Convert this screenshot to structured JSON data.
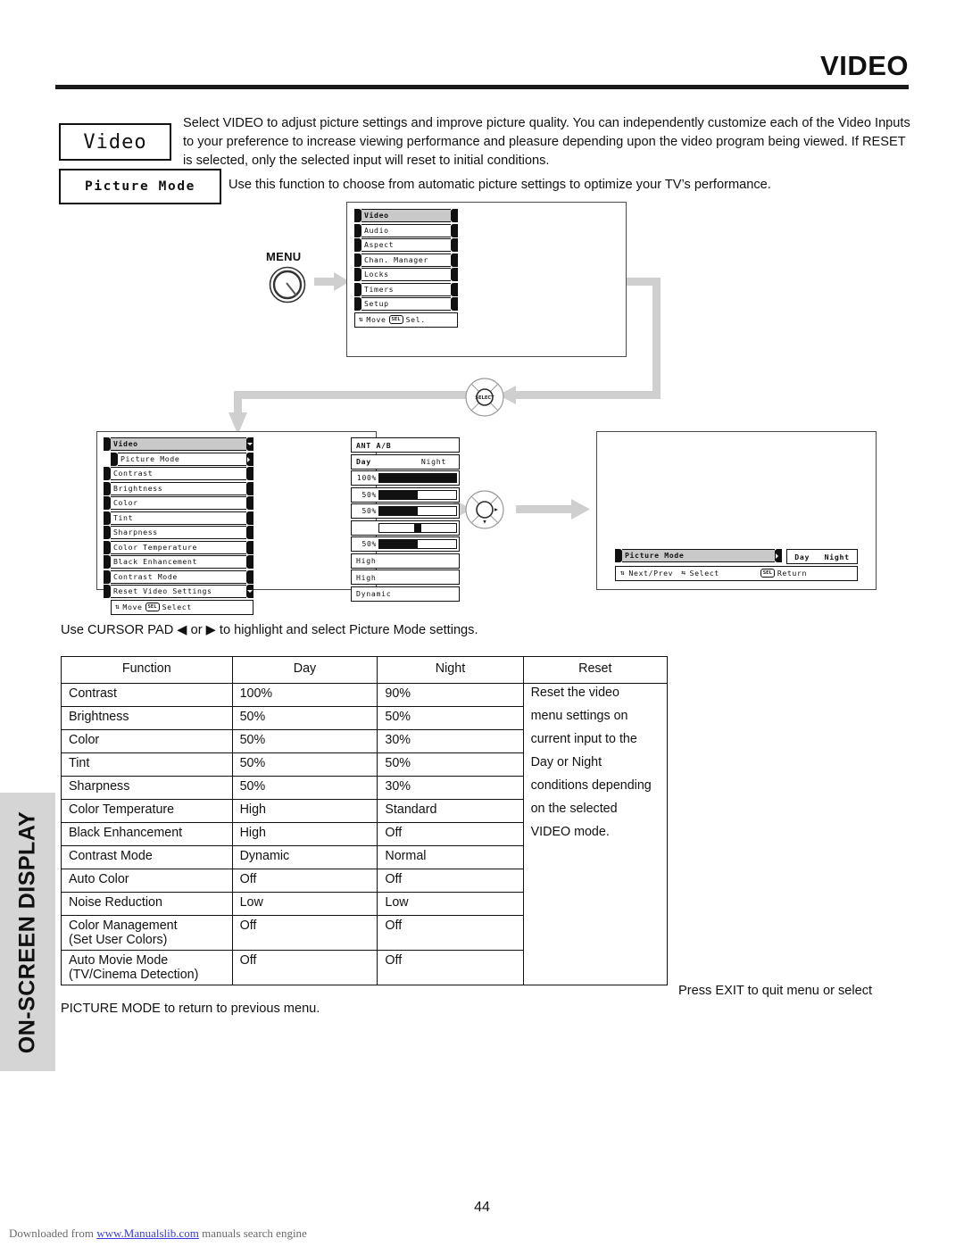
{
  "header": {
    "title": "VIDEO"
  },
  "intro": {
    "video_label": "Video",
    "paragraph": "Select VIDEO to adjust picture settings and improve picture quality.  You can independently customize each of the Video Inputs to your preference to increase viewing performance and pleasure depending upon the video program being viewed.  If RESET is selected, only the selected input will reset to initial conditions.",
    "picture_mode_label": "Picture Mode",
    "picture_mode_desc": "Use this function to choose from automatic picture settings to optimize your TV’s performance."
  },
  "menu_knob": {
    "label": "MENU"
  },
  "main_menu_screen": {
    "items": [
      {
        "label": "Video",
        "selected": true
      },
      {
        "label": "Audio",
        "selected": false
      },
      {
        "label": "Aspect",
        "selected": false
      },
      {
        "label": "Chan. Manager",
        "selected": false
      },
      {
        "label": "Locks",
        "selected": false
      },
      {
        "label": "Timers",
        "selected": false
      },
      {
        "label": "Setup",
        "selected": false
      }
    ],
    "hint_move": "Move",
    "hint_sel_chip": "SEL",
    "hint_sel": "Sel."
  },
  "video_menu_screen": {
    "title": "Video",
    "items": [
      {
        "label": "Picture Mode",
        "cap": "arrow-r"
      },
      {
        "label": "Contrast",
        "cap": "plain"
      },
      {
        "label": "Brightness",
        "cap": "plain"
      },
      {
        "label": "Color",
        "cap": "plain"
      },
      {
        "label": "Tint",
        "cap": "plain"
      },
      {
        "label": "Sharpness",
        "cap": "plain"
      },
      {
        "label": "Color Temperature",
        "cap": "plain"
      },
      {
        "label": "Black Enhancement",
        "cap": "plain"
      },
      {
        "label": "Contrast Mode",
        "cap": "plain"
      },
      {
        "label": "Reset Video Settings",
        "cap": "arrow-d"
      }
    ],
    "hint_move": "Move",
    "hint_sel_chip": "SEL",
    "hint_select": "Select",
    "values": [
      {
        "kind": "text",
        "text": "ANT A/B"
      },
      {
        "kind": "daynight",
        "day": "Day",
        "night": "Night"
      },
      {
        "kind": "bar",
        "pct": "100%",
        "fill": 100
      },
      {
        "kind": "bar",
        "pct": "50%",
        "fill": 50
      },
      {
        "kind": "bar",
        "pct": "50%",
        "fill": 50
      },
      {
        "kind": "thumb",
        "pct": "",
        "pos": 50
      },
      {
        "kind": "bar",
        "pct": "50%",
        "fill": 50
      },
      {
        "kind": "text",
        "text": "High"
      },
      {
        "kind": "text",
        "text": "High"
      },
      {
        "kind": "text",
        "text": "Dynamic"
      }
    ]
  },
  "picture_mode_screen": {
    "row_label": "Picture Mode",
    "day": "Day",
    "night": "Night",
    "hint_nextprev": "Next/Prev",
    "hint_select": "Select",
    "hint_sel_chip": "SEL",
    "hint_return": "Return"
  },
  "cursor_sentence": {
    "before": "Use CURSOR PAD ",
    "left_glyph": "◀",
    "middle": " or ",
    "right_glyph": "▶",
    "after": " to highlight and select Picture Mode settings."
  },
  "settings_table": {
    "headers": [
      "Function",
      "Day",
      "Night",
      "Reset"
    ],
    "rows": [
      {
        "function": "Contrast",
        "sub": "",
        "day": "100%",
        "night": "90%"
      },
      {
        "function": "Brightness",
        "sub": "",
        "day": "50%",
        "night": "50%"
      },
      {
        "function": "Color",
        "sub": "",
        "day": "50%",
        "night": "30%"
      },
      {
        "function": "Tint",
        "sub": "",
        "day": "50%",
        "night": "50%"
      },
      {
        "function": "Sharpness",
        "sub": "",
        "day": "50%",
        "night": "30%"
      },
      {
        "function": "Color Temperature",
        "sub": "",
        "day": "High",
        "night": "Standard"
      },
      {
        "function": "Black Enhancement",
        "sub": "",
        "day": "High",
        "night": "Off"
      },
      {
        "function": "Contrast Mode",
        "sub": "",
        "day": "Dynamic",
        "night": "Normal"
      },
      {
        "function": "Auto Color",
        "sub": "",
        "day": "Off",
        "night": "Off"
      },
      {
        "function": "Noise Reduction",
        "sub": "",
        "day": "Low",
        "night": "Low"
      },
      {
        "function": "Color Management",
        "sub": "(Set User Colors)",
        "day": "Off",
        "night": "Off"
      },
      {
        "function": "Auto Movie Mode",
        "sub": "(TV/Cinema Detection)",
        "day": "Off",
        "night": "Off"
      }
    ],
    "reset_lines": [
      "Reset the video",
      "menu settings on",
      "current input to the",
      "Day or Night",
      "conditions depending",
      "on the selected",
      "VIDEO mode."
    ]
  },
  "side_tab": {
    "label": "ON-SCREEN DISPLAY"
  },
  "notes": {
    "press_exit": "Press EXIT to quit menu or select",
    "picture_mode_return": "PICTURE MODE to return to previous menu."
  },
  "footer": {
    "page_number": "44",
    "download_prefix": "Downloaded from ",
    "download_link": "www.Manualslib.com",
    "download_suffix": " manuals search engine"
  },
  "colors": {
    "ink": "#111111",
    "flow_gray": "#cfcfcf",
    "tab_gray": "#d5d5d5",
    "highlight_gray": "#c9c9c9",
    "link_blue": "#3b3bdd"
  }
}
